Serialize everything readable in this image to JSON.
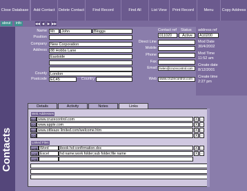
{
  "toolbar": {
    "close": "Close Database",
    "add": "Add Contact",
    "delete": "Delete Contact",
    "find_record": "Find Record",
    "find_all": "Find All",
    "list_view": "List View",
    "print": "Print Record",
    "menu": "Menu",
    "copy": "Copy Address"
  },
  "nav": {
    "about": "about",
    "info": "info",
    "arrows": [
      "◀◀",
      "◀",
      "▶",
      "▶▶"
    ]
  },
  "side_title": "Contacts",
  "contact": {
    "name_label": "Name",
    "salutation": "Mr",
    "first": "John",
    "last": "Bloggs",
    "position_label": "Position",
    "company_label": "Company",
    "company": "New Corporation",
    "address_label": "Address",
    "address1": "88 Hobbs Lane",
    "address2": "Eastside",
    "address3": "",
    "county_label": "County",
    "county": "London",
    "postcode_label": "Postcode",
    "postcode": "EC45",
    "country_label": "Country",
    "country": ""
  },
  "mid": {
    "contact_ref_label": "Contact ref",
    "contact_ref": "011020",
    "status_label": "Status",
    "status": "Active",
    "direct_label": "Direct Line",
    "mobile_label": "Mobile",
    "phone_label": "Phone",
    "fax_label": "Fax",
    "email_label": "Email",
    "email": "helen@cruzecontrol.com",
    "web_label": "Web",
    "web": "www.cruzecontrol.com"
  },
  "right": {
    "address_ref_label": "address ref",
    "address_ref": "A10200",
    "mod_date_label": "Mod Date",
    "mod_date": "30/4/2002",
    "mod_time_label": "Mod Time",
    "mod_time": "11:52 am",
    "create_date_label": "Create date",
    "create_date": "8/12/2001",
    "create_time_label": "Create time",
    "create_time": "2:27 pm"
  },
  "tabs": [
    "Details",
    "Activity",
    "Notes",
    "Links"
  ],
  "links": {
    "web_section": "Web Addresses",
    "go": "GO",
    "clear": "X",
    "browse": "...",
    "urls": [
      "www.cruzecontrol.com",
      "www.apple.com",
      "www.ottleaze limited.com/welcome.htm",
      ""
    ],
    "files_section": "Linked Files",
    "link_btn": "Link",
    "files": [
      {
        "type": "Word",
        "path": "ibook hd:confirmation.doc"
      },
      {
        "type": "Excel",
        "path": "hd name;work folder;sub folder;file name"
      },
      {
        "type": "",
        "path": ""
      }
    ]
  }
}
